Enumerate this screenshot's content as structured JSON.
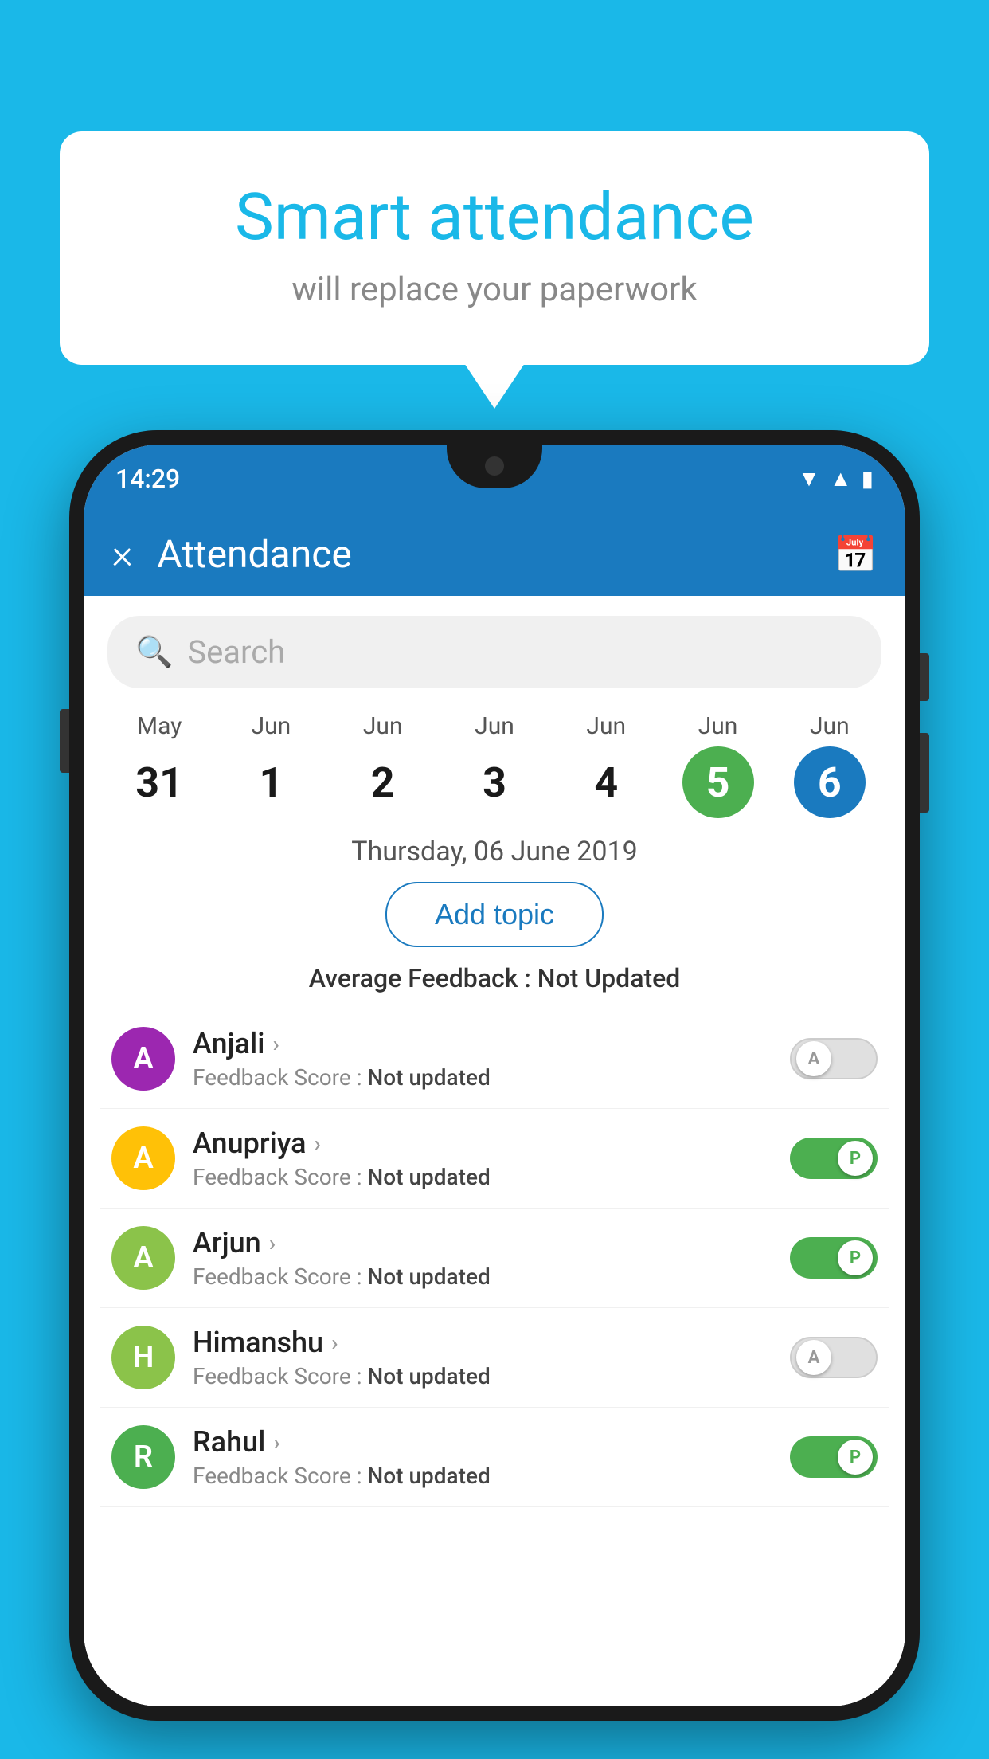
{
  "background_color": "#1ab8e8",
  "bubble": {
    "title": "Smart attendance",
    "subtitle": "will replace your paperwork"
  },
  "status_bar": {
    "time": "14:29",
    "icons": [
      "wifi",
      "signal",
      "battery"
    ]
  },
  "toolbar": {
    "title": "Attendance",
    "close_label": "×",
    "calendar_icon": "📅"
  },
  "search": {
    "placeholder": "Search"
  },
  "calendar": {
    "days": [
      {
        "month": "May",
        "date": "31",
        "style": "normal"
      },
      {
        "month": "Jun",
        "date": "1",
        "style": "normal"
      },
      {
        "month": "Jun",
        "date": "2",
        "style": "normal"
      },
      {
        "month": "Jun",
        "date": "3",
        "style": "normal"
      },
      {
        "month": "Jun",
        "date": "4",
        "style": "normal"
      },
      {
        "month": "Jun",
        "date": "5",
        "style": "green"
      },
      {
        "month": "Jun",
        "date": "6",
        "style": "blue"
      }
    ]
  },
  "selected_date": "Thursday, 06 June 2019",
  "add_topic_label": "Add topic",
  "avg_feedback_label": "Average Feedback :",
  "avg_feedback_value": "Not Updated",
  "students": [
    {
      "name": "Anjali",
      "initial": "A",
      "avatar_color": "#9c27b0",
      "score_label": "Feedback Score :",
      "score_value": "Not updated",
      "toggle": "off",
      "toggle_label": "A"
    },
    {
      "name": "Anupriya",
      "initial": "A",
      "avatar_color": "#ffc107",
      "score_label": "Feedback Score :",
      "score_value": "Not updated",
      "toggle": "on",
      "toggle_label": "P"
    },
    {
      "name": "Arjun",
      "initial": "A",
      "avatar_color": "#8bc34a",
      "score_label": "Feedback Score :",
      "score_value": "Not updated",
      "toggle": "on",
      "toggle_label": "P"
    },
    {
      "name": "Himanshu",
      "initial": "H",
      "avatar_color": "#8bc34a",
      "score_label": "Feedback Score :",
      "score_value": "Not updated",
      "toggle": "off",
      "toggle_label": "A"
    },
    {
      "name": "Rahul",
      "initial": "R",
      "avatar_color": "#4caf50",
      "score_label": "Feedback Score :",
      "score_value": "Not updated",
      "toggle": "on",
      "toggle_label": "P"
    }
  ]
}
